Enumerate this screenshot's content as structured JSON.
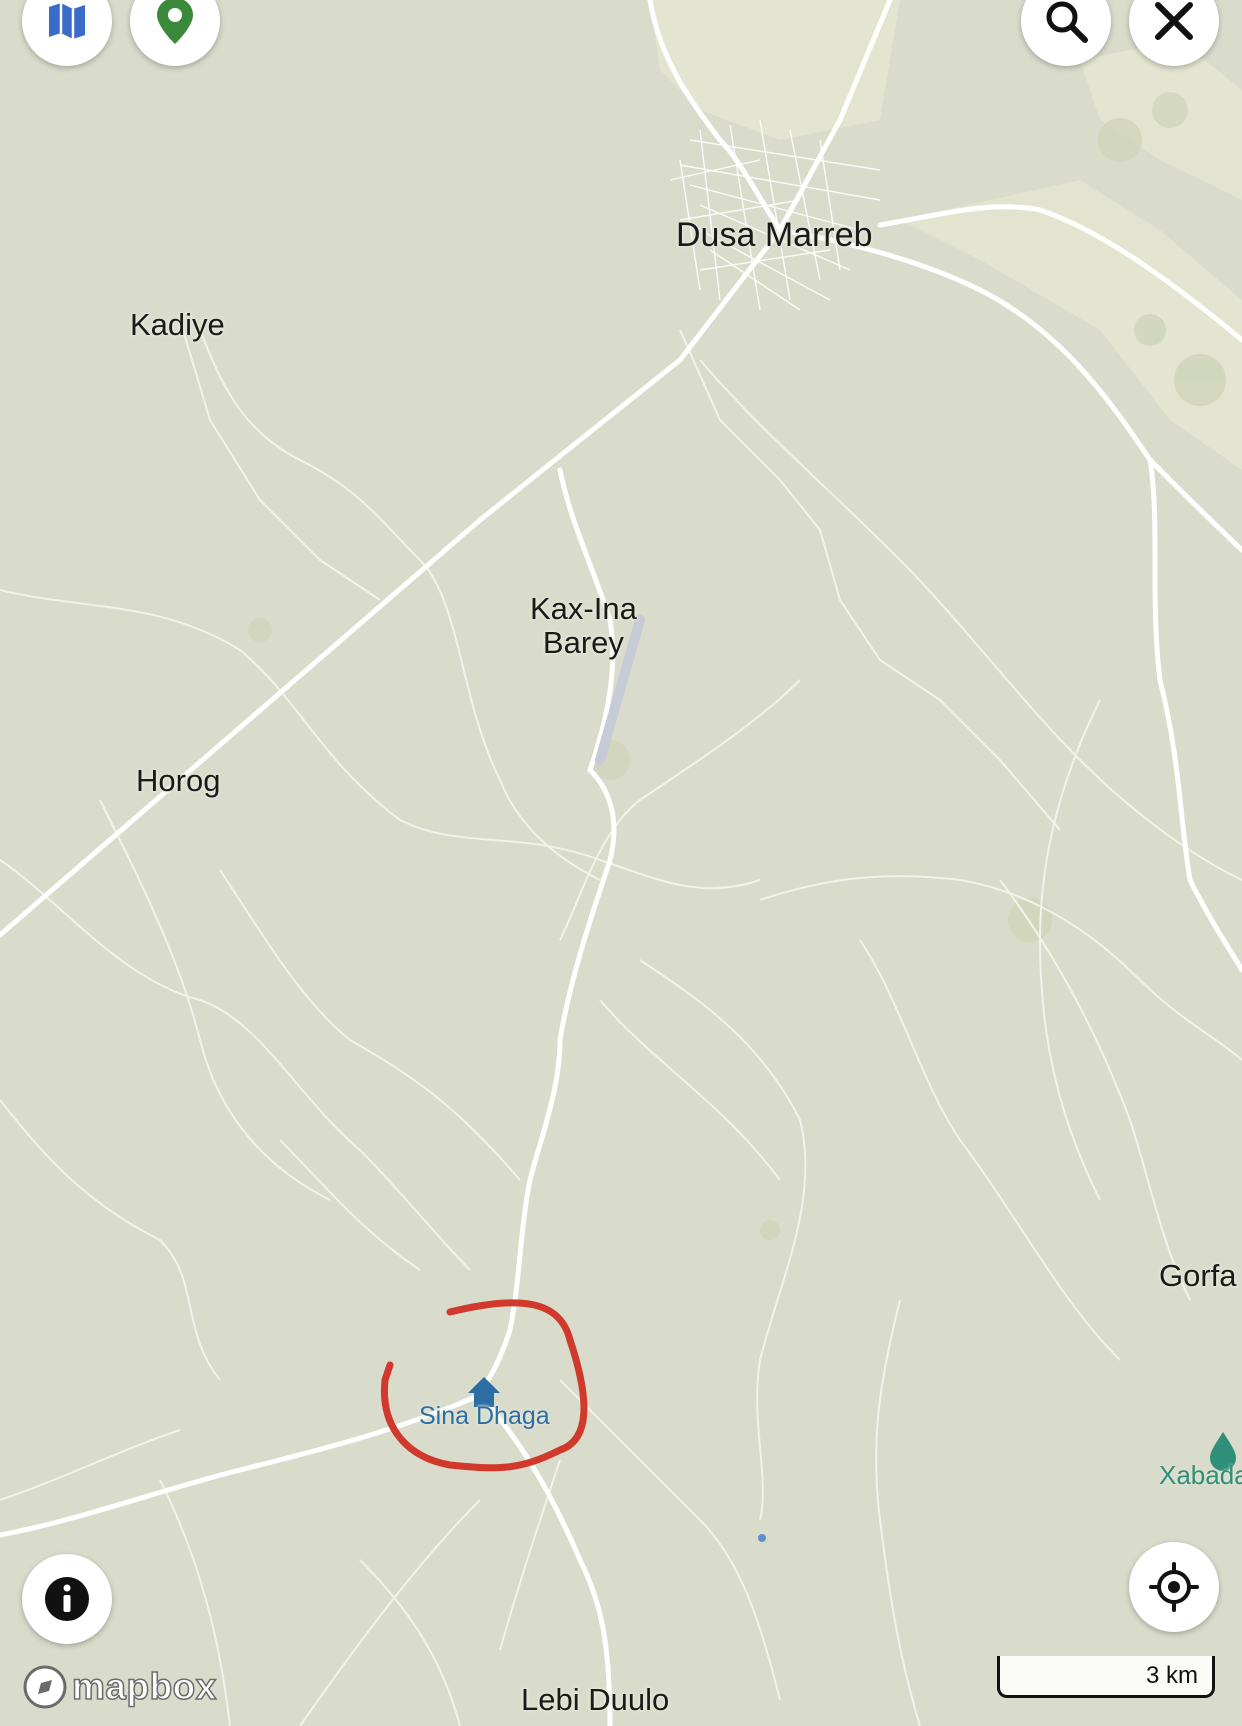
{
  "toolbar": {
    "layers_icon": "map-fold-icon",
    "pin_icon": "map-pin-icon",
    "search_icon": "magnifier-icon",
    "close_icon": "x-icon"
  },
  "places": {
    "dusa_marreb": "Dusa Marreb",
    "kadiye": "Kadiye",
    "kax_ina_barey_line1": "Kax-Ina",
    "kax_ina_barey_line2": "Barey",
    "horog": "Horog",
    "gorfa": "Gorfa",
    "lebi_duulo": "Lebi Duulo"
  },
  "poi": {
    "sina_dhaga": "Sina Dhaga",
    "xabada": "Xabada"
  },
  "attribution": {
    "logo_text": "mapbox"
  },
  "scale": {
    "label": "3 km"
  },
  "colors": {
    "land": "#d9dbcb",
    "road": "#ffffff",
    "annotation": "#d0392b",
    "poi": "#2c6ea3",
    "water_poi": "#2f8f79",
    "layers_icon": "#3a6bc9",
    "pin_icon": "#3b8a3b"
  }
}
